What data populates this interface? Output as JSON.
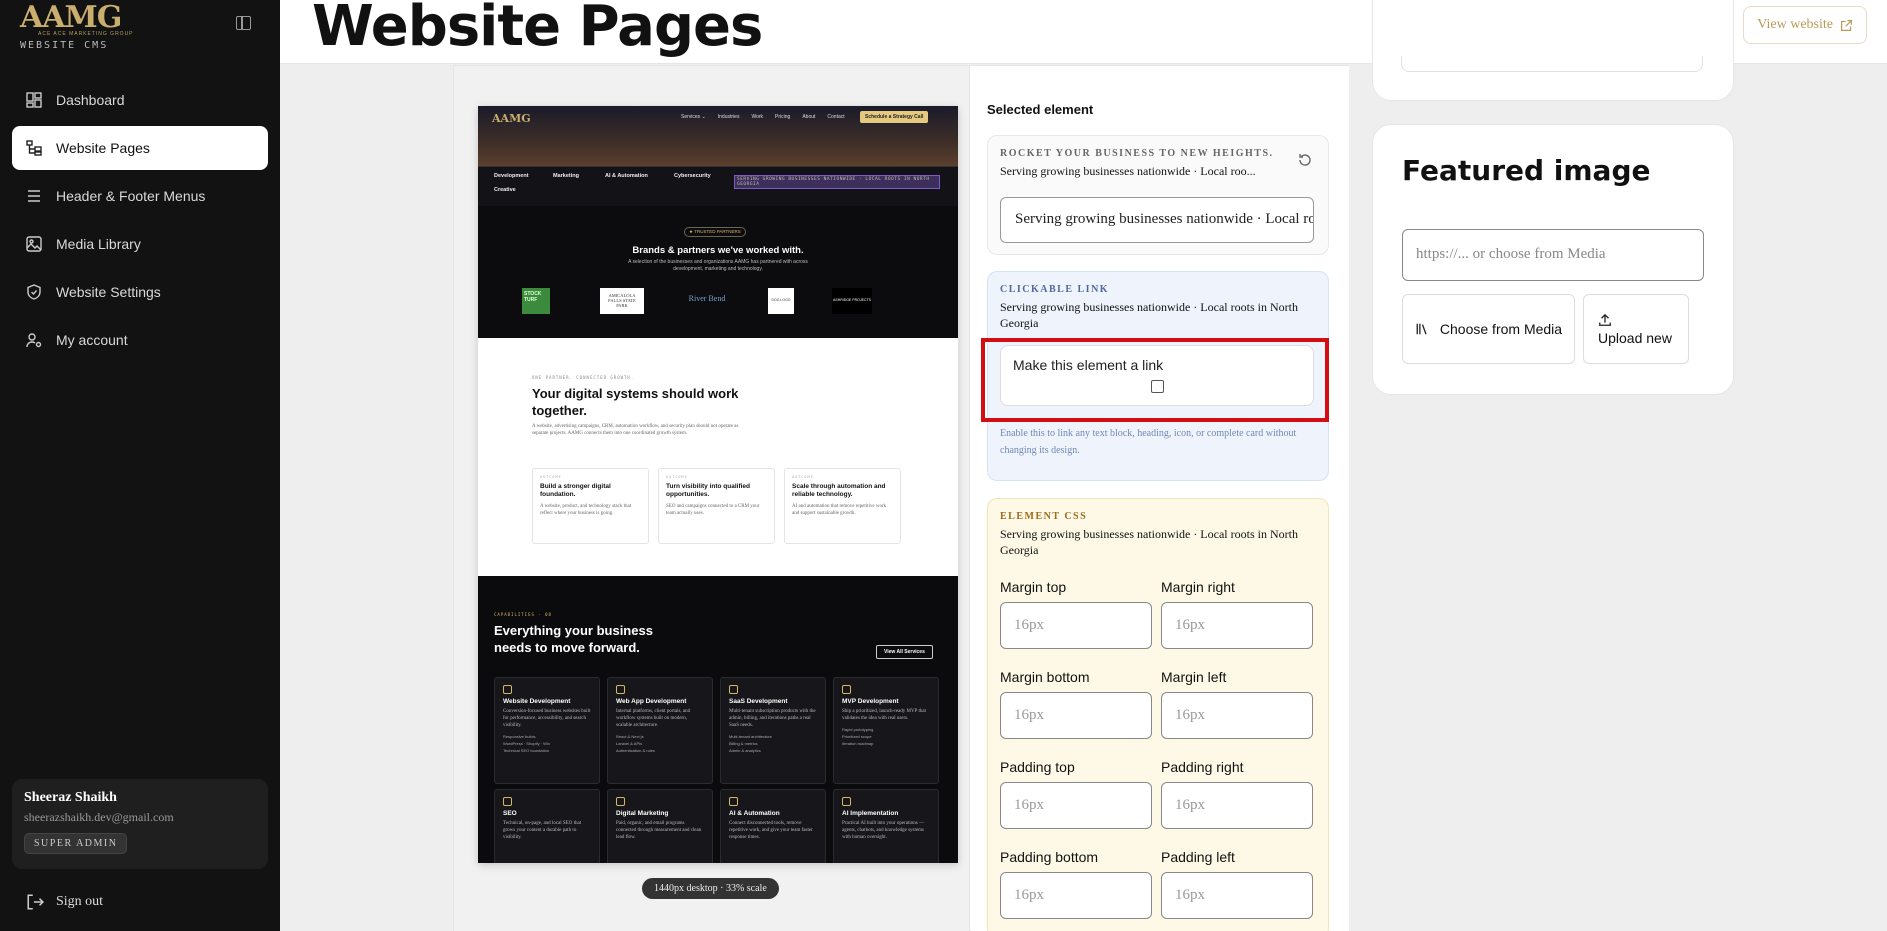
{
  "sidebar": {
    "logo_text": "AAMG",
    "logo_tagline": "ACE ACE MARKETING GROUP",
    "cms_label": "WEBSITE CMS",
    "nav": [
      {
        "label": "Dashboard",
        "icon": "dashboard-icon",
        "active": false
      },
      {
        "label": "Website Pages",
        "icon": "pages-tree-icon",
        "active": true
      },
      {
        "label": "Header & Footer Menus",
        "icon": "menu-icon",
        "active": false
      },
      {
        "label": "Media Library",
        "icon": "image-icon",
        "active": false
      },
      {
        "label": "Website Settings",
        "icon": "shield-icon",
        "active": false
      },
      {
        "label": "My account",
        "icon": "user-gear-icon",
        "active": false
      }
    ],
    "user": {
      "name": "Sheeraz Shaikh",
      "email": "sheerazshaikh.dev@gmail.com",
      "role": "SUPER ADMIN"
    },
    "sign_out": "Sign out"
  },
  "topbar": {
    "title": "Website Pages",
    "view_website": "View website"
  },
  "preview": {
    "scale_label": "1440px desktop · 33% scale",
    "site": {
      "logo": "AAMG",
      "nav_links": [
        "Services ⌄",
        "Industries",
        "Work",
        "Pricing",
        "About",
        "Contact"
      ],
      "cta": "Schedule a Strategy Call",
      "categories": [
        "Development",
        "Marketing",
        "AI & Automation",
        "Cybersecurity",
        "Creative"
      ],
      "marquee": "SERVING GROWING BUSINESSES NATIONWIDE · LOCAL ROOTS IN NORTH GEORGIA",
      "partners_pill": "★ TRUSTED PARTNERS",
      "partners_title": "Brands & partners we've worked with.",
      "partners_sub": "A selection of the businesses and organizations AAMG has partnered with across development, marketing and technology.",
      "partner_logos": [
        "STOCK TURF",
        "AMICALOLA FALLS STATE PARK",
        "River Bend",
        "DOG LOGO",
        "ASHRIDGE PROJECTS"
      ],
      "section_kicker": "ONE PARTNER. CONNECTED GROWTH.",
      "section_title": "Your digital systems should work together.",
      "section_body": "A website, advertising campaigns, CRM, automation workflow, and security plan should not operate as separate projects. AAMG connects them into one coordinated growth system.",
      "outcome_cards": [
        {
          "kicker": "OUTCOME",
          "title": "Build a stronger digital foundation.",
          "body": "A website, product, and technology stack that reflect where your business is going."
        },
        {
          "kicker": "OUTCOME",
          "title": "Turn visibility into qualified opportunities.",
          "body": "SEO and campaigns connected to a CRM your team actually uses."
        },
        {
          "kicker": "OUTCOME",
          "title": "Scale through automation and reliable technology.",
          "body": "AI and automation that remove repetitive work and support sustainable growth."
        }
      ],
      "capabilities_kicker": "CAPABILITIES · 08",
      "capabilities_title": "Everything your business needs to move forward.",
      "view_all": "View All Services",
      "services": [
        {
          "title": "Website Development",
          "body": "Conversion-focused business websites built for performance, accessibility, and search visibility.",
          "bullets": [
            "Responsive builds",
            "WordPress · Shopify · Wix",
            "Technical SEO foundation"
          ]
        },
        {
          "title": "Web App Development",
          "body": "Internal platforms, client portals, and workflow systems built on modern, scalable architecture.",
          "bullets": [
            "React & Next.js",
            "Laravel & APIs",
            "Authentication & roles"
          ]
        },
        {
          "title": "SaaS Development",
          "body": "Multi-tenant subscription products with the admin, billing, and iterations paths a real SaaS needs.",
          "bullets": [
            "Multi-tenant architecture",
            "Billing & metrics",
            "Admin & analytics"
          ]
        },
        {
          "title": "MVP Development",
          "body": "Ship a prioritized, launch-ready MVP that validates the idea with real users.",
          "bullets": [
            "Rapid prototyping",
            "Prioritized scope",
            "Iteration roadmap"
          ]
        },
        {
          "title": "SEO",
          "body": "Technical, on-page, and local SEO that grows your content a durable path to visibility.",
          "bullets": []
        },
        {
          "title": "Digital Marketing",
          "body": "Paid, organic, and email programs connected through measurement and clean lead flow.",
          "bullets": []
        },
        {
          "title": "AI & Automation",
          "body": "Connect disconnected tools, remove repetitive work, and give your team faster response times.",
          "bullets": []
        },
        {
          "title": "AI Implementation",
          "body": "Practical AI built into your operations — agents, chatbots, and knowledge systems with human oversight.",
          "bullets": []
        }
      ]
    }
  },
  "panel": {
    "selected_title": "Selected element",
    "content_box": {
      "label": "ROCKET YOUR BUSINESS TO NEW HEIGHTS.",
      "value": "Serving growing businesses nationwide · Local roo...",
      "input_value": "Serving growing businesses nationwide · Local roots in North Georgia"
    },
    "link_box": {
      "label": "CLICKABLE LINK",
      "value": "Serving growing businesses nationwide · Local roots in North Georgia",
      "toggle_label": "Make this element a link",
      "checked": false,
      "hint": "Enable this to link any text block, heading, icon, or complete card without changing its design."
    },
    "css_box": {
      "label": "ELEMENT CSS",
      "value": "Serving growing businesses nationwide · Local roots in North Georgia",
      "fields": [
        {
          "label": "Margin top",
          "placeholder": "16px"
        },
        {
          "label": "Margin right",
          "placeholder": "16px"
        },
        {
          "label": "Margin bottom",
          "placeholder": "16px"
        },
        {
          "label": "Margin left",
          "placeholder": "16px"
        },
        {
          "label": "Padding top",
          "placeholder": "16px"
        },
        {
          "label": "Padding right",
          "placeholder": "16px"
        },
        {
          "label": "Padding bottom",
          "placeholder": "16px"
        },
        {
          "label": "Padding left",
          "placeholder": "16px"
        }
      ]
    }
  },
  "featured": {
    "title": "Featured image",
    "placeholder": "https://... or choose from Media",
    "choose_label": "Choose from Media",
    "upload_label": "Upload new"
  },
  "colors": {
    "sidebar_bg": "#121212",
    "accent_gold": "#c9ae6e",
    "highlight_red": "#d40d12",
    "link_box_bg": "#eef3fc",
    "css_box_bg": "#fdf9e6"
  }
}
